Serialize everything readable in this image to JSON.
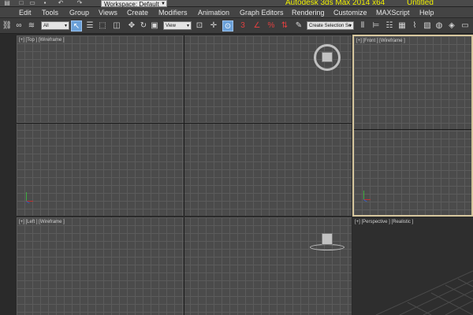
{
  "titlebar": {
    "workspace": "Workspace: Default",
    "app_title": "Autodesk 3ds Max  2014 x64",
    "doc_title": "Untitled",
    "quick_access_icons": [
      "app-menu-icon",
      "new-icon",
      "open-icon",
      "save-icon",
      "undo-icon",
      "redo-icon"
    ]
  },
  "menu": {
    "items": [
      "Edit",
      "Tools",
      "Group",
      "Views",
      "Create",
      "Modifiers",
      "Animation",
      "Graph Editors",
      "Rendering",
      "Customize",
      "MAXScript",
      "Help"
    ]
  },
  "toolbar": {
    "selection_filter": "All",
    "reference_coord": "View",
    "selection_set": "Create Selection Se"
  },
  "viewports": {
    "top": {
      "label": "[+] [Top ] [Wireframe ]"
    },
    "front": {
      "label": "[+] [Front ] [Wireframe ]"
    },
    "left": {
      "label": "[+] [Left ] [Wireframe ]"
    },
    "perspective": {
      "label": "[+] [Perspective ] [Realistic ]"
    },
    "active_viewport": "front",
    "colors": {
      "viewport_bg": "#4b4b4b",
      "grid_line": "#5b5b5b",
      "axis_line": "#1a1a1a",
      "active_border": "#d7c79e",
      "perspective_bg": "#2e2e2e",
      "title_text": "#f2f200"
    }
  }
}
